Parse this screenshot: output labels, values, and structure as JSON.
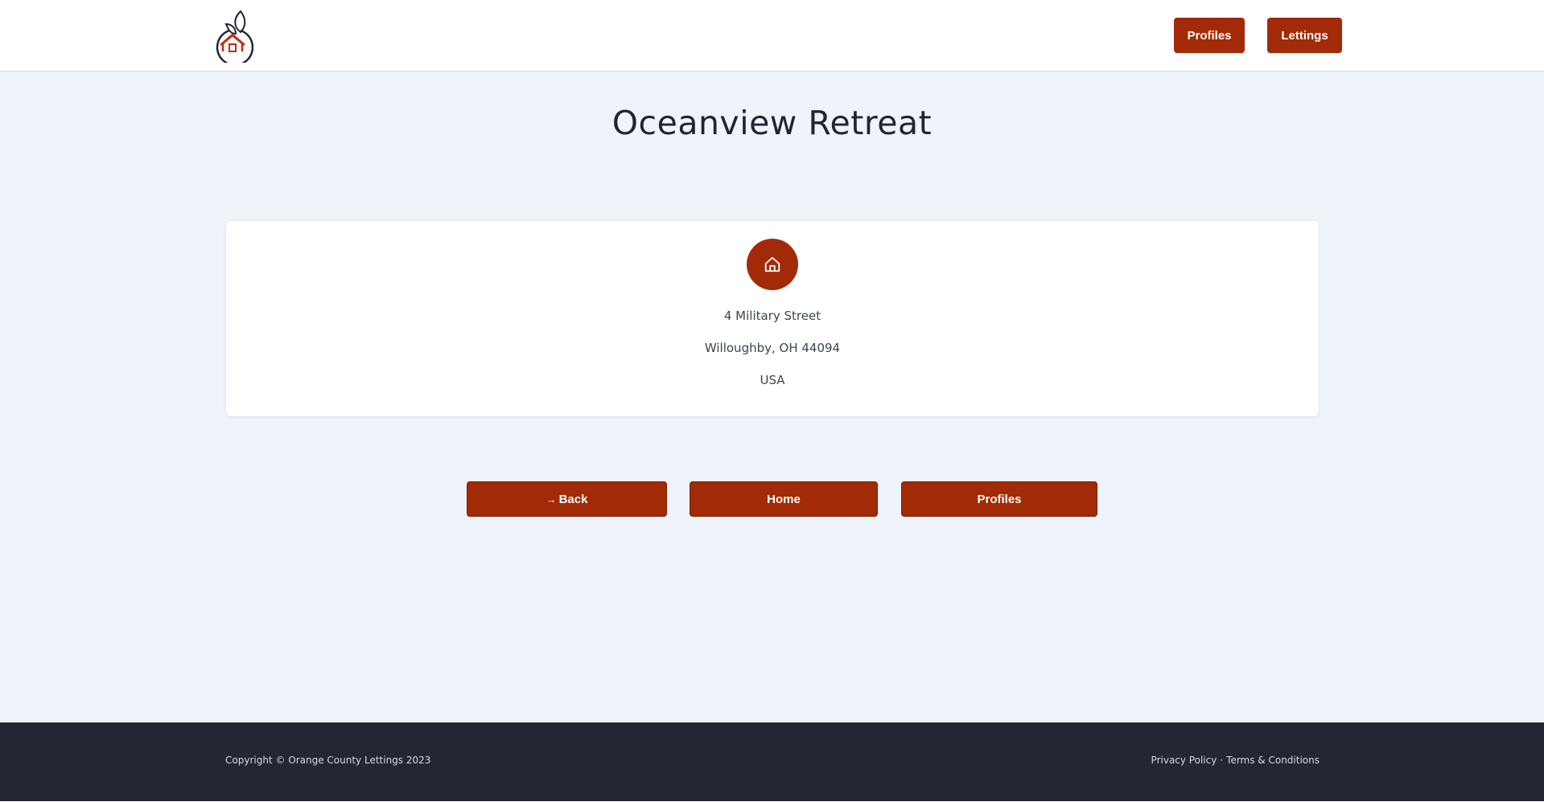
{
  "header": {
    "logo_icon": "orange-house-logo-icon",
    "nav": {
      "profiles_label": "Profiles",
      "lettings_label": "Lettings"
    }
  },
  "main": {
    "title": "Oceanview Retreat",
    "card": {
      "icon": "home-icon",
      "address_line1": "4 Military Street",
      "address_line2": "Willoughby, OH 44094",
      "address_line3": "USA"
    },
    "actions": {
      "back_icon": "arrow-right-icon",
      "back_glyph": "→",
      "back_label": "Back",
      "home_label": "Home",
      "profiles_label": "Profiles"
    }
  },
  "footer": {
    "copyright": "Copyright © Orange County Lettings 2023",
    "privacy_label": "Privacy Policy",
    "separator": "·",
    "terms_label": "Terms & Conditions"
  },
  "colors": {
    "accent": "#a22a06",
    "background": "#eff4fb",
    "footer_bg": "#222733"
  }
}
